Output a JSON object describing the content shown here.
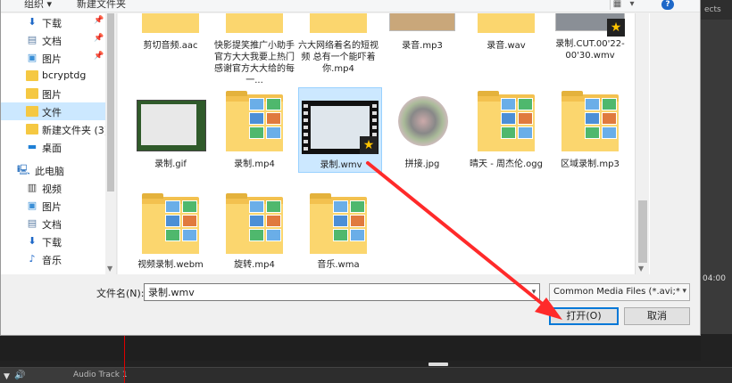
{
  "background_app": {
    "right_panel_label": "ects",
    "timecode": "04:00",
    "audio_track_label": "Audio Track 1"
  },
  "toolbar": {
    "organize_label": "组织 ▾",
    "new_folder_label": "新建文件夹"
  },
  "nav": {
    "items": [
      {
        "label": "下载",
        "icon": "down-arrow-icon",
        "pinned": true
      },
      {
        "label": "文档",
        "icon": "document-icon",
        "pinned": true
      },
      {
        "label": "图片",
        "icon": "picture-icon",
        "pinned": true
      },
      {
        "label": "bcryptdg",
        "icon": "folder-icon",
        "pinned": false
      },
      {
        "label": "图片",
        "icon": "folder-icon",
        "pinned": false
      },
      {
        "label": "文件",
        "icon": "folder-icon",
        "pinned": false,
        "selected": true
      },
      {
        "label": "新建文件夹 (3)",
        "icon": "folder-icon",
        "pinned": false
      },
      {
        "label": "桌面",
        "icon": "desktop-icon",
        "pinned": false
      },
      {
        "label": "此电脑",
        "icon": "computer-icon",
        "pinned": false,
        "root": true
      },
      {
        "label": "视频",
        "icon": "video-icon",
        "pinned": false
      },
      {
        "label": "图片",
        "icon": "picture-icon",
        "pinned": false
      },
      {
        "label": "文档",
        "icon": "document-icon",
        "pinned": false
      },
      {
        "label": "下载",
        "icon": "down-arrow-icon",
        "pinned": false
      },
      {
        "label": "音乐",
        "icon": "music-icon",
        "pinned": false
      }
    ]
  },
  "files": {
    "row1": [
      {
        "name": "剪切音频.aac"
      },
      {
        "name": "快影提笑推广小助手官方大大我要上热门感谢官方大大给的每一..."
      },
      {
        "name": "六大网络着名的短视频 总有一个能吓着你.mp4"
      },
      {
        "name": "录音.mp3"
      },
      {
        "name": "录音.wav"
      },
      {
        "name": "录制.CUT.00'22-00'30.wmv"
      }
    ],
    "row2": [
      {
        "name": "录制.gif"
      },
      {
        "name": "录制.mp4"
      },
      {
        "name": "录制.wmv",
        "selected": true
      },
      {
        "name": "拼接.jpg"
      },
      {
        "name": "晴天 - 周杰伦.ogg"
      },
      {
        "name": "区域录制.mp3"
      }
    ],
    "row3": [
      {
        "name": "视频录制.webm"
      },
      {
        "name": "旋转.mp4"
      },
      {
        "name": "音乐.wma"
      }
    ]
  },
  "bottom": {
    "filename_label": "文件名(N):",
    "filename_value": "录制.wmv",
    "filter_value": "Common Media Files (*.avi;*",
    "open_label": "打开(O)",
    "cancel_label": "取消"
  },
  "colors": {
    "selection": "#cce8ff",
    "accent": "#0078d7",
    "annotation": "#ff2a2a",
    "folder": "#f3c14f"
  }
}
